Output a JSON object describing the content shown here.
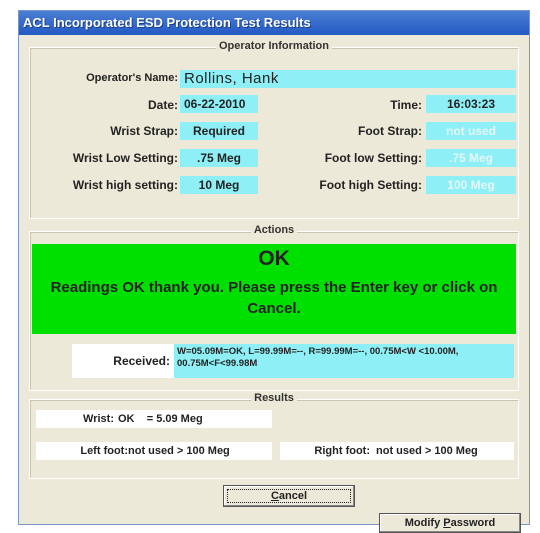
{
  "window": {
    "title": "ACL Incorporated ESD Protection Test Results"
  },
  "operator": {
    "legend": "Operator Information",
    "name_label": "Operator's Name:",
    "name_value": "Rollins, Hank",
    "date_label": "Date:",
    "date_value": "06-22-2010",
    "time_label": "Time:",
    "time_value": "16:03:23",
    "wrist_strap_label": "Wrist Strap:",
    "wrist_strap_value": "Required",
    "foot_strap_label": "Foot Strap:",
    "foot_strap_value": "not used",
    "wrist_low_label": "Wrist Low Setting:",
    "wrist_low_value": ".75 Meg",
    "foot_low_label": "Foot low Setting:",
    "foot_low_value": ".75 Meg",
    "wrist_high_label": "Wrist high setting:",
    "wrist_high_value": "10 Meg",
    "foot_high_label": "Foot high Setting:",
    "foot_high_value": "100 Meg"
  },
  "actions": {
    "legend": "Actions",
    "status": "OK",
    "message": "Readings OK thank you.  Please press the Enter key or click on Cancel.",
    "received_label": "Received:",
    "received_value": "W=05.09M=OK, L=99.99M=--, R=99.99M=--, 00.75M<W <10.00M, 00.75M<F<99.98M"
  },
  "results": {
    "legend": "Results",
    "wrist_label": "Wrist:",
    "wrist_value": "OK    = 5.09 Meg",
    "left_foot_label": "Left foot:",
    "left_foot_value": "not used > 100 Meg",
    "right_foot_label": "Right foot:",
    "right_foot_value": "not used > 100 Meg"
  },
  "buttons": {
    "cancel_prefix": "C",
    "cancel_rest": "ancel",
    "modify_prefix": "Modify ",
    "modify_hot": "P",
    "modify_rest": "assword"
  },
  "colors": {
    "field_bg": "#8ef0f6",
    "status_bg": "#00e000",
    "title_bar": "#2459c4"
  }
}
